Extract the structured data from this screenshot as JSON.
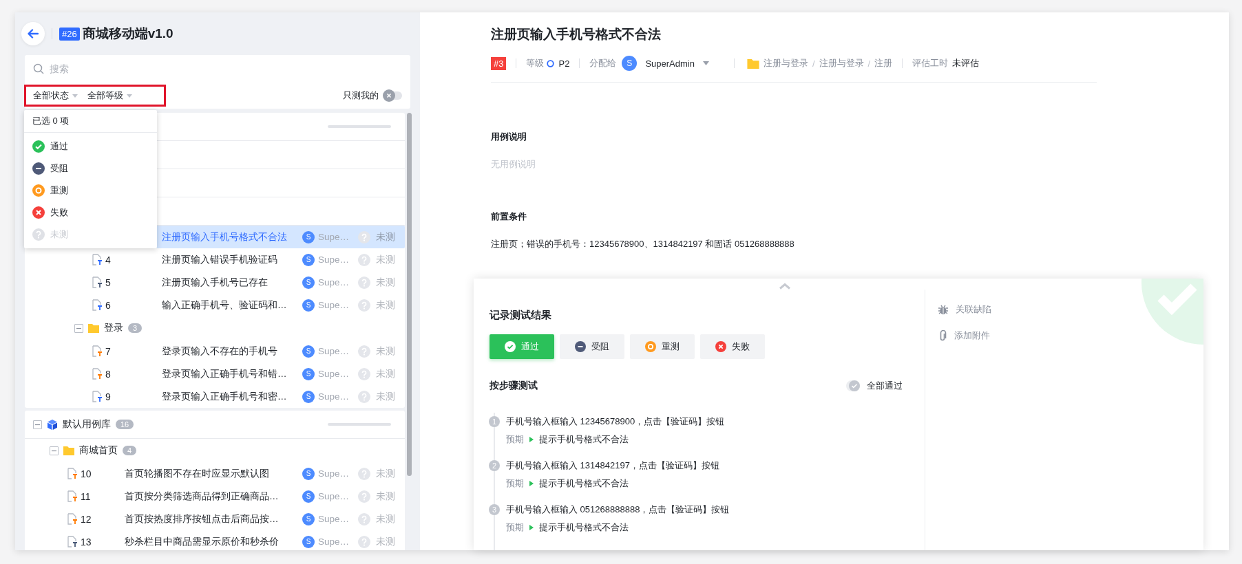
{
  "header": {
    "badge": "#26",
    "title": "商城移动端v1.0"
  },
  "search": {
    "placeholder": "搜索"
  },
  "filters": [
    {
      "label": "全部状态"
    },
    {
      "label": "全部等级"
    }
  ],
  "only_mine": {
    "label": "只测我的",
    "on": false
  },
  "status_dropdown": {
    "summary": "已选 0 项",
    "options": [
      {
        "kind": "pass",
        "label": "通过",
        "disabled": false
      },
      {
        "kind": "blocked",
        "label": "受阻",
        "disabled": false
      },
      {
        "kind": "retest",
        "label": "重测",
        "disabled": false
      },
      {
        "kind": "fail",
        "label": "失败",
        "disabled": false
      },
      {
        "kind": "untested",
        "label": "未测",
        "disabled": true
      }
    ]
  },
  "tree_top": {
    "progress": {
      "level": 0
    },
    "items": [
      {
        "kind": "case",
        "title": "注册页输入手机号格式不合法",
        "assignee_initial": "S",
        "assignee": "Supe…",
        "result": "未测",
        "selected": true
      },
      {
        "kind": "case",
        "number": "4",
        "color": "#2f6bff",
        "title": "注册页输入错误手机验证码",
        "assignee_initial": "S",
        "assignee": "Supe…",
        "result": "未测",
        "selected": false
      },
      {
        "kind": "case",
        "number": "5",
        "color": "#4a5a78",
        "title": "注册页输入手机号已存在",
        "assignee_initial": "S",
        "assignee": "Supe…",
        "result": "未测",
        "selected": false
      },
      {
        "kind": "case",
        "number": "6",
        "color": "#2f6bff",
        "title": "输入正确手机号、验证码和…",
        "assignee_initial": "S",
        "assignee": "Supe…",
        "result": "未测",
        "selected": false
      },
      {
        "kind": "folder",
        "name": "登录",
        "count": "3",
        "expanded": true,
        "children": [
          {
            "number": "7",
            "color": "#ff7a00",
            "title": "登录页输入不存在的手机号",
            "assignee_initial": "S",
            "assignee": "Supe…",
            "result": "未测",
            "selected": false
          },
          {
            "number": "8",
            "color": "#ff7a00",
            "title": "登录页输入正确手机号和错…",
            "assignee_initial": "S",
            "assignee": "Supe…",
            "result": "未测",
            "selected": false
          },
          {
            "number": "9",
            "color": "#2f6bff",
            "title": "登录页输入正确手机号和密…",
            "assignee_initial": "S",
            "assignee": "Supe…",
            "result": "未测",
            "selected": false
          }
        ]
      }
    ]
  },
  "tree_bottom": {
    "library": {
      "name": "默认用例库",
      "count": "16",
      "expanded": true,
      "progress": {
        "level": 0
      },
      "children": [
        {
          "name": "商城首页",
          "count": "4",
          "expanded": true,
          "children": [
            {
              "number": "10",
              "color": "#ff7a00",
              "title": "首页轮播图不存在时应显示默认图",
              "assignee_initial": "S",
              "assignee": "Supe…",
              "result": "未测",
              "selected": false
            },
            {
              "number": "11",
              "color": "#ff7a00",
              "title": "首页按分类筛选商品得到正确商品…",
              "assignee_initial": "S",
              "assignee": "Supe…",
              "result": "未测",
              "selected": false
            },
            {
              "number": "12",
              "color": "#ff7a00",
              "title": "首页按热度排序按钮点击后商品按…",
              "assignee_initial": "S",
              "assignee": "Supe…",
              "result": "未测",
              "selected": false
            },
            {
              "number": "13",
              "color": "#4a5a78",
              "title": "秒杀栏目中商品需显示原价和秒杀价",
              "assignee_initial": "S",
              "assignee": "Supe…",
              "result": "未测",
              "selected": false
            }
          ]
        }
      ]
    }
  },
  "detail": {
    "title": "注册页输入手机号格式不合法",
    "id_badge": "#3",
    "priority_label": "等级",
    "priority": "P2",
    "assign_label": "分配给",
    "assignee_initial": "S",
    "assignee": "SuperAdmin",
    "path": [
      "注册与登录",
      "注册与登录",
      "注册"
    ],
    "path_separator": "/",
    "estimate_label": "评估工时",
    "estimate": "未评估",
    "sections": [
      {
        "heading": "用例说明",
        "text": "无用例说明",
        "empty": true
      },
      {
        "heading": "前置条件",
        "text": "注册页；错误的手机号：12345678900、1314842197 和固话 051268888888",
        "empty": false
      }
    ]
  },
  "result_panel": {
    "title": "记录测试结果",
    "buttons": [
      {
        "kind": "pass",
        "label": "通过",
        "selected": true
      },
      {
        "kind": "blocked",
        "label": "受阻",
        "selected": false
      },
      {
        "kind": "retest",
        "label": "重测",
        "selected": false
      },
      {
        "kind": "fail",
        "label": "失败",
        "selected": false
      }
    ],
    "steps_title": "按步骤测试",
    "all_pass": {
      "label": "全部通过",
      "on": false
    },
    "steps": [
      {
        "number": "1",
        "action": "手机号输入框输入 12345678900，点击【验证码】按钮",
        "expected_label": "预期",
        "expected": "提示手机号格式不合法"
      },
      {
        "number": "2",
        "action": "手机号输入框输入 1314842197，点击【验证码】按钮",
        "expected_label": "预期",
        "expected": "提示手机号格式不合法"
      },
      {
        "number": "3",
        "action": "手机号输入框输入 051268888888，点击【验证码】按钮",
        "expected_label": "预期",
        "expected": "提示手机号格式不合法"
      }
    ],
    "links": [
      {
        "kind": "bug",
        "label": "关联缺陷"
      },
      {
        "kind": "attachment",
        "label": "添加附件"
      }
    ],
    "passed_mark": true
  }
}
